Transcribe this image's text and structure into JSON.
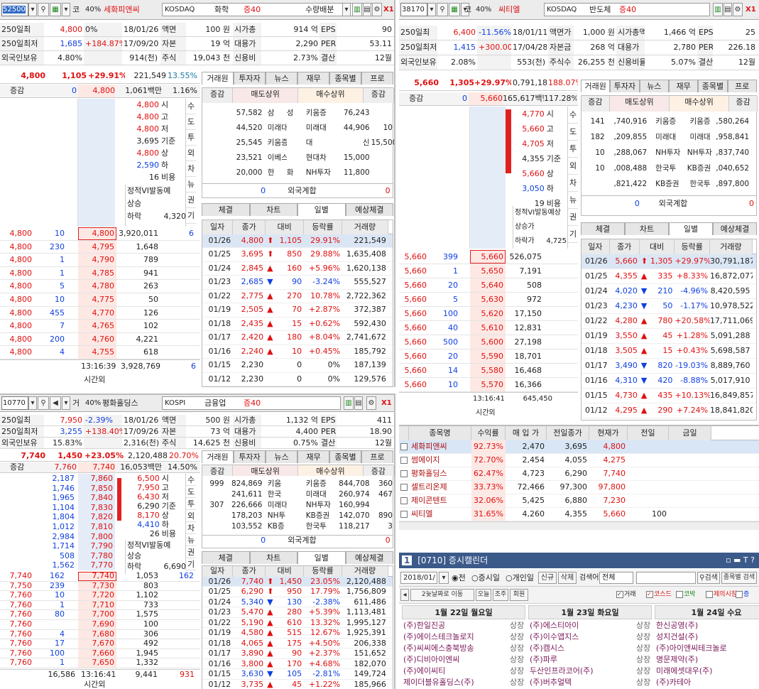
{
  "p1": {
    "code": "52500",
    "market_tag": "코",
    "pct": "40%",
    "name": "세화피앤씨",
    "market": "KOSDAQ",
    "sector": "화학",
    "margin": "증40",
    "mode": "수량배분",
    "info": [
      [
        "250일최",
        "4,800",
        "0%",
        "18/01/26",
        "액면",
        "100 원",
        "시가총",
        "914 억",
        "EPS",
        "90"
      ],
      [
        "250일최저",
        "1,685",
        "+184.87%",
        "17/09/20",
        "자본",
        "19 억",
        "대용가",
        "2,290",
        "PER",
        "53.11"
      ],
      [
        "외국인보유",
        "4.80%",
        "",
        "914(천)",
        "주식",
        "19,043 천",
        "신용비",
        "2.73%",
        "결산",
        "12월"
      ]
    ],
    "price": "4,800",
    "change": "1,105",
    "rate": "+29.91%",
    "volume": "221,549",
    "turnover": "13.55%",
    "sub": {
      "label": "증감",
      "v1": "0",
      "v2": "4,800",
      "v3": "1,061백만",
      "v4": "1.16%"
    },
    "ohlc": [
      [
        "4,800",
        "시"
      ],
      [
        "4,800",
        "고"
      ],
      [
        "4,800",
        "저"
      ],
      [
        "3,695",
        "기준"
      ],
      [
        "4,800",
        "상"
      ],
      [
        "2,590",
        "하"
      ],
      [
        "16",
        "비용"
      ]
    ],
    "vi": "정적VI발동예",
    "up": "상승",
    "down": "하락",
    "down_v": "4,320",
    "side": [
      "수",
      "도",
      "투",
      "외",
      "차",
      "뉴",
      "권",
      "기"
    ],
    "book": [
      [
        "4,800",
        "10",
        "4,800",
        "3,920,011",
        "6"
      ],
      [
        "4,800",
        "230",
        "4,795",
        "1,648",
        ""
      ],
      [
        "4,800",
        "1",
        "4,790",
        "789",
        ""
      ],
      [
        "4,800",
        "1",
        "4,785",
        "941",
        ""
      ],
      [
        "4,800",
        "5",
        "4,780",
        "263",
        ""
      ],
      [
        "4,800",
        "10",
        "4,775",
        "50",
        ""
      ],
      [
        "4,800",
        "455",
        "4,770",
        "126",
        ""
      ],
      [
        "4,800",
        "7",
        "4,765",
        "102",
        ""
      ],
      [
        "4,800",
        "200",
        "4,760",
        "4,221",
        ""
      ],
      [
        "4,800",
        "4",
        "4,755",
        "618",
        ""
      ]
    ],
    "book_time": "13:16:39",
    "book_total": "3,928,769",
    "book_total2": "6",
    "book_after": "시간외",
    "tabs": [
      "거래원",
      "투자자",
      "뉴스",
      "재무",
      "종목별",
      "프로"
    ],
    "broker_hdr": [
      "증감",
      "매도상위",
      "매수상위",
      "증감"
    ],
    "brokers": [
      [
        "",
        "57,582",
        "삼",
        "성",
        "키움증",
        "76,243",
        ""
      ],
      [
        "",
        "44,520",
        "미래대",
        "",
        "미래대",
        "44,906",
        "10"
      ],
      [
        "",
        "25,545",
        "키움증",
        "",
        "대",
        "신",
        "15,500"
      ],
      [
        "",
        "23,521",
        "이베스",
        "",
        "현대차",
        "15,000",
        ""
      ],
      [
        "",
        "20,000",
        "한",
        "화",
        "NH투자",
        "11,800",
        ""
      ]
    ],
    "foreign": [
      "0",
      "외국계합",
      "0"
    ],
    "dtabs": [
      "체결",
      "차트",
      "일별",
      "예상체결"
    ],
    "daily_hdr": [
      "일자",
      "종가",
      "대비",
      "등락률",
      "거래량"
    ],
    "daily": [
      [
        "01/26",
        "4,800",
        "up",
        "1,105",
        "29.91%",
        "221,549"
      ],
      [
        "01/25",
        "3,695",
        "up",
        "850",
        "29.88%",
        "1,635,408"
      ],
      [
        "01/24",
        "2,845",
        "tri",
        "160",
        "+5.96%",
        "1,620,138"
      ],
      [
        "01/23",
        "2,685",
        "dn",
        "90",
        "-3.24%",
        "555,527"
      ],
      [
        "01/22",
        "2,775",
        "tri",
        "270",
        "10.78%",
        "2,722,362"
      ],
      [
        "01/19",
        "2,505",
        "tri",
        "70",
        "+2.87%",
        "372,387"
      ],
      [
        "01/18",
        "2,435",
        "tri",
        "15",
        "+0.62%",
        "592,430"
      ],
      [
        "01/17",
        "2,420",
        "tri",
        "180",
        "+8.04%",
        "2,741,672"
      ],
      [
        "01/16",
        "2,240",
        "tri",
        "10",
        "+0.45%",
        "185,792"
      ],
      [
        "01/15",
        "2,230",
        "",
        "0",
        "0%",
        "187,139"
      ],
      [
        "01/12",
        "2,230",
        "",
        "0",
        "0%",
        "129,576"
      ]
    ]
  },
  "p2": {
    "code": "38170",
    "name": "씨티엘",
    "market": "KOSDAQ",
    "sector": "반도체",
    "margin": "증40",
    "pct": "40%",
    "market_tag": "코",
    "info": [
      [
        "250일최",
        "6,400",
        "-11.56%",
        "18/01/11",
        "액면가",
        "1,000 원",
        "시가총액",
        "1,466 억",
        "EPS",
        "25"
      ],
      [
        "250일최저",
        "1,415",
        "+300.00%",
        "17/04/28",
        "자본금",
        "268 억",
        "대용가",
        "2,780",
        "PER",
        "226.18"
      ],
      [
        "외국인보유",
        "2.08%",
        "",
        "553(천)",
        "주식수",
        "26,255 천",
        "신용비율",
        "5.07%",
        "결산월",
        "12월"
      ]
    ],
    "price": "5,660",
    "change": "1,305",
    "rate": "+29.97%",
    "volume": "0,791,187",
    "turnover": "188.07%",
    "sub": {
      "label": "증감",
      "v1": "0",
      "v2": "5,660",
      "v3": "165,617백만",
      "v4": "117.28%"
    },
    "ohlc": [
      [
        "4,770",
        "시"
      ],
      [
        "5,660",
        "고"
      ],
      [
        "4,705",
        "저"
      ],
      [
        "4,355",
        "기준"
      ],
      [
        "5,660",
        "상"
      ],
      [
        "3,050",
        "하"
      ],
      [
        "19",
        "비용"
      ]
    ],
    "vi": "정적VI발동예상",
    "up": "상승가",
    "down": "하락가",
    "down_v": "4,725",
    "side": [
      "수",
      "도",
      "투",
      "외",
      "차",
      "뉴",
      "권",
      "기"
    ],
    "book": [
      [
        "5,660",
        "399",
        "5,660",
        "526,075"
      ],
      [
        "5,660",
        "1",
        "5,650",
        "7,191"
      ],
      [
        "5,660",
        "20",
        "5,640",
        "508"
      ],
      [
        "5,660",
        "5",
        "5,630",
        "972"
      ],
      [
        "5,660",
        "100",
        "5,620",
        "17,150"
      ],
      [
        "5,660",
        "40",
        "5,610",
        "12,831"
      ],
      [
        "5,660",
        "500",
        "5,600",
        "27,198"
      ],
      [
        "5,660",
        "20",
        "5,590",
        "18,701"
      ],
      [
        "5,660",
        "14",
        "5,580",
        "16,468"
      ],
      [
        "5,660",
        "10",
        "5,570",
        "16,366"
      ]
    ],
    "book_time": "13:16:41",
    "book_total": "645,450",
    "book_after": "시간외",
    "tabs": [
      "거래원",
      "투자자",
      "뉴스",
      "재무",
      "종목별",
      "프로"
    ],
    "broker_hdr": [
      "증감",
      "매도상위",
      "매수상위",
      "증감"
    ],
    "brokers": [
      [
        "141",
        ",740,916",
        "키움증",
        "키움증",
        ",580,264"
      ],
      [
        "182",
        ",209,855",
        "미래대",
        "미래대",
        ",958,841"
      ],
      [
        "10",
        ",288,067",
        "NH투자",
        "NH투자",
        ",837,740"
      ],
      [
        "10",
        ",008,488",
        "한국투",
        "KB증권",
        ",040,652"
      ],
      [
        "",
        ",821,422",
        "KB증권",
        "한국투",
        ",897,800"
      ]
    ],
    "foreign": [
      "0",
      "외국계합",
      "0"
    ],
    "dtabs": [
      "체결",
      "차트",
      "일별",
      "예상체결"
    ],
    "daily_hdr": [
      "일자",
      "종가",
      "대비",
      "등락률",
      "거래량"
    ],
    "daily": [
      [
        "01/26",
        "5,660",
        "up",
        "1,305",
        "+29.97%",
        "30,791,187"
      ],
      [
        "01/25",
        "4,355",
        "tri",
        "335",
        "+8.33%",
        "16,872,077"
      ],
      [
        "01/24",
        "4,020",
        "dn",
        "210",
        "-4.96%",
        "8,420,595"
      ],
      [
        "01/23",
        "4,230",
        "dn",
        "50",
        "-1.17%",
        "10,978,522"
      ],
      [
        "01/22",
        "4,280",
        "tri",
        "780",
        "+20.58%",
        "17,711,069"
      ],
      [
        "01/19",
        "3,550",
        "tri",
        "45",
        "+1.28%",
        "5,091,288"
      ],
      [
        "01/18",
        "3,505",
        "tri",
        "15",
        "+0.43%",
        "5,698,587"
      ],
      [
        "01/17",
        "3,490",
        "dn",
        "820",
        "-19.03%",
        "8,889,760"
      ],
      [
        "01/16",
        "4,310",
        "dn",
        "420",
        "-8.88%",
        "5,017,910"
      ],
      [
        "01/15",
        "4,730",
        "tri",
        "435",
        "+10.13%",
        "16,849,857"
      ],
      [
        "01/12",
        "4,295",
        "tri",
        "290",
        "+7.24%",
        "18,841,820"
      ]
    ]
  },
  "p3": {
    "code": "10770",
    "market_tag": "거",
    "pct": "40%",
    "name": "평화홀딩스",
    "market": "KOSPI",
    "sector": "금융업",
    "margin": "증40",
    "info": [
      [
        "250일최",
        "7,950",
        "-2.39%",
        "18/01/26",
        "액면",
        "500 원",
        "시가총",
        "1,132 억",
        "EPS",
        "411"
      ],
      [
        "250일최저",
        "3,255",
        "+138.40%",
        "17/09/26",
        "자본",
        "73 억",
        "대용가",
        "4,400",
        "PER",
        "18.90"
      ],
      [
        "외국인보유",
        "15.83%",
        "",
        "2,316(천)",
        "주식",
        "14,625 천",
        "신용비",
        "0.75%",
        "결산",
        "12월"
      ]
    ],
    "price": "7,740",
    "change": "1,450",
    "rate": "+23.05%",
    "volume": "2,120,488",
    "turnover": "20.70%",
    "sub": {
      "label": "증감",
      "v1": "7,760",
      "v2": "7,740",
      "v3": "16,053백만",
      "v4": "14.50%"
    },
    "ohlc": [
      [
        "6,500",
        "시"
      ],
      [
        "7,950",
        "고"
      ],
      [
        "6,430",
        "저"
      ],
      [
        "6,290",
        "기준"
      ],
      [
        "8,170",
        "상"
      ],
      [
        "4,410",
        "하"
      ],
      [
        "26",
        "비용"
      ]
    ],
    "vi": "정적VI발동예",
    "up": "상승",
    "down": "하락",
    "down_v": "6,690",
    "side": [
      "수",
      "도",
      "투",
      "외",
      "차",
      "뉴",
      "권",
      "기"
    ],
    "ask": [
      [
        "2,187",
        "7,860"
      ],
      [
        "1,746",
        "7,850"
      ],
      [
        "1,965",
        "7,840"
      ],
      [
        "1,104",
        "7,830"
      ],
      [
        "1,804",
        "7,820"
      ],
      [
        "1,012",
        "7,810"
      ],
      [
        "2,984",
        "7,800"
      ],
      [
        "1,714",
        "7,790"
      ],
      [
        "508",
        "7,780"
      ],
      [
        "1,562",
        "7,770"
      ]
    ],
    "book": [
      [
        "7,740",
        "162",
        "7,740",
        "1,053",
        "162"
      ],
      [
        "7,750",
        "239",
        "7,730",
        "803",
        ""
      ],
      [
        "7,760",
        "10",
        "7,720",
        "1,102",
        ""
      ],
      [
        "7,760",
        "1",
        "7,710",
        "733",
        ""
      ],
      [
        "7,760",
        "80",
        "7,700",
        "1,575",
        ""
      ],
      [
        "7,760",
        "",
        "7,690",
        "100",
        ""
      ],
      [
        "7,760",
        "4",
        "7,680",
        "306",
        ""
      ],
      [
        "7,760",
        "17",
        "7,670",
        "492",
        ""
      ],
      [
        "7,760",
        "100",
        "7,660",
        "1,945",
        ""
      ],
      [
        "7,760",
        "1",
        "7,650",
        "1,332",
        ""
      ]
    ],
    "book_time": "13:16:41",
    "book_total_l": "16,586",
    "book_total": "9,441",
    "book_total2": "931",
    "book_after": "시간외",
    "tabs": [
      "거래원",
      "투자자",
      "뉴스",
      "재무",
      "종목별",
      "프로"
    ],
    "broker_hdr": [
      "증감",
      "매도상위",
      "매수상위",
      "증감"
    ],
    "brokers": [
      [
        "999",
        "824,869",
        "키움",
        "",
        "키움증",
        "844,708",
        "360"
      ],
      [
        "",
        "241,611",
        "한국",
        "",
        "미래대",
        "260,974",
        "467"
      ],
      [
        "307",
        "226,666",
        "미래대",
        "",
        "NH투자",
        "160,994",
        ""
      ],
      [
        "",
        "178,203",
        "NH투",
        "",
        "KB증권",
        "142,070",
        "890"
      ],
      [
        "",
        "103,552",
        "KB증",
        "",
        "한국투",
        "118,217",
        "3"
      ]
    ],
    "foreign": [
      "0",
      "외국계합",
      "0"
    ],
    "dtabs": [
      "체결",
      "차트",
      "일별",
      "예상체결"
    ],
    "daily_hdr": [
      "일자",
      "종가",
      "대비",
      "등락률",
      "거래량"
    ],
    "daily": [
      [
        "01/26",
        "7,740",
        "up",
        "1,450",
        "23.05%",
        "2,120,488"
      ],
      [
        "01/25",
        "6,290",
        "up",
        "950",
        "17.79%",
        "1,756,809"
      ],
      [
        "01/24",
        "5,340",
        "dn",
        "130",
        "-2.38%",
        "611,486"
      ],
      [
        "01/23",
        "5,470",
        "tri",
        "280",
        "+5.39%",
        "1,113,481"
      ],
      [
        "01/22",
        "5,190",
        "tri",
        "610",
        "13.32%",
        "1,995,127"
      ],
      [
        "01/19",
        "4,580",
        "tri",
        "515",
        "12.67%",
        "1,925,391"
      ],
      [
        "01/18",
        "4,065",
        "tri",
        "175",
        "+4.50%",
        "206,338"
      ],
      [
        "01/17",
        "3,890",
        "tri",
        "90",
        "+2.37%",
        "151,652"
      ],
      [
        "01/16",
        "3,800",
        "tri",
        "170",
        "+4.68%",
        "182,070"
      ],
      [
        "01/15",
        "3,630",
        "dn",
        "105",
        "-2.81%",
        "149,724"
      ],
      [
        "01/12",
        "3,735",
        "tri",
        "45",
        "+1.22%",
        "185,966"
      ]
    ]
  },
  "watch": {
    "hdr": [
      "종목명",
      "수익률",
      "매 입 가",
      "전일종가",
      "현재가",
      "전일",
      "금일"
    ],
    "rows": [
      [
        "세화피앤씨",
        "92.73%",
        "2,470",
        "3,695",
        "4,800",
        "",
        ""
      ],
      [
        "썸에이지",
        "72.70%",
        "2,454",
        "4,055",
        "4,275",
        "",
        ""
      ],
      [
        "평화홀딩스",
        "62.47%",
        "4,723",
        "6,290",
        "7,740",
        "",
        ""
      ],
      [
        "셀트리온제",
        "33.73%",
        "72,466",
        "97,300",
        "97,800",
        "",
        ""
      ],
      [
        "제이콘텐트",
        "32.06%",
        "5,425",
        "6,880",
        "7,230",
        "",
        ""
      ],
      [
        "씨티엘",
        "31.65%",
        "4,260",
        "4,355",
        "5,660",
        "100",
        ""
      ]
    ]
  },
  "cal": {
    "title": "[0710] 증시캘린더",
    "num": "1",
    "date": "2018/01/",
    "opts": [
      "전",
      "증시일",
      "개인일"
    ],
    "b1": "신규",
    "b2": "삭제",
    "search_lbl": "검색어",
    "search_sel": "전체",
    "search_btn": "검색",
    "b3": "종목별 검색",
    "row2": [
      "2늦날짜로 이동",
      "오늘",
      "조주",
      "회원"
    ],
    "checks": [
      "거래",
      "코스드",
      "코박",
      "제의시장",
      "증"
    ],
    "days": [
      "1월 22일 월요일",
      "1월 23일 화요일",
      "1월 24일 수요"
    ],
    "items": [
      [
        "(주)한일진공",
        "상장",
        "(주)에스티아이",
        "상장",
        "한신공영(주)"
      ],
      [
        "(주)에이스테크놀로지",
        "상장",
        "(주)이수앱지스",
        "상장",
        "성지건설(주)"
      ],
      [
        "(주)씨씨에스충북방송",
        "상장",
        "(주)캠시스",
        "상장",
        "(주)아이앤씨테크놀로"
      ],
      [
        "(주)디비아이엔씨",
        "상장",
        "(주)파루",
        "상장",
        "명문제약(주)"
      ],
      [
        "(주)에이씨티",
        "상장",
        "두산인프라코어(주)",
        "상장",
        "미래에셋대우(주)"
      ],
      [
        "제이더블유홀딩스(주)",
        "상장",
        "(주)버추얼텍",
        "상장",
        "(주)카테아"
      ]
    ]
  },
  "colors": {
    "up": "#e01010",
    "down": "#1040e0",
    "select": "#316ac5",
    "pink": "#fde8e4"
  }
}
